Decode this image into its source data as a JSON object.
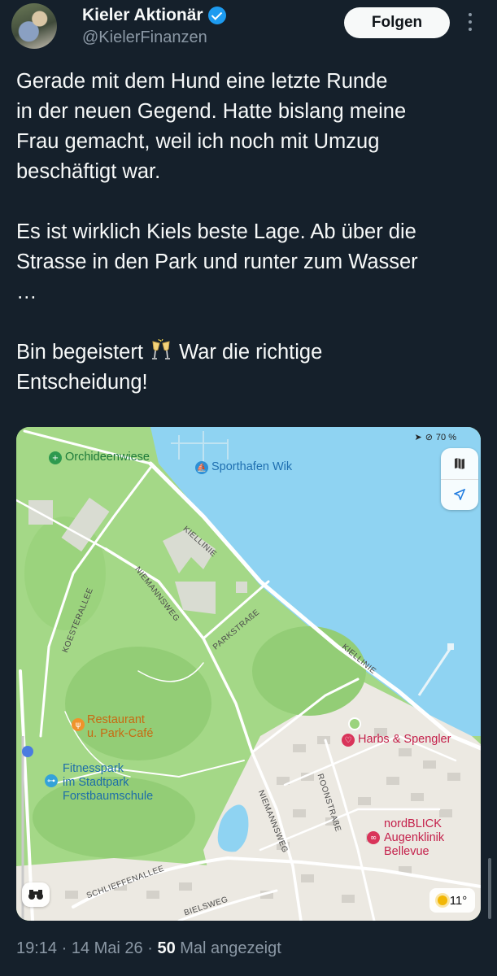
{
  "author": {
    "name": "Kieler Aktionär",
    "handle": "@KielerFinanzen",
    "verified": true,
    "avatar": "avatar-photo"
  },
  "header": {
    "follow_label": "Folgen",
    "more_icon": "more-vertical-icon"
  },
  "tweet": {
    "text_1": "Gerade mit dem Hund eine letzte Runde\nin der neuen Gegend. Hatte bislang meine\nFrau gemacht, weil ich noch mit Umzug\nbeschäftigt war.\n\nEs ist wirklich Kiels beste Lage. Ab über die\nStrasse in den Park und runter zum Wasser\n…\n\nBin begeistert ",
    "emoji": "clinking-glasses-emoji",
    "text_2": " War die richtige\nEntscheidung!"
  },
  "map": {
    "status": {
      "battery": "70 %"
    },
    "pois": {
      "orchideenwiese": "Orchideenwiese",
      "sporthafen": "Sporthafen Wik",
      "restaurant": "Restaurant\nu. Park-Café",
      "fitnesspark": "Fitnesspark\nim Stadtpark\nForstbaumschule",
      "harbs": "Harbs & Spengler",
      "nordblick": "nordBLICK\nAugenklinik\nBellevue"
    },
    "streets": {
      "kiellinie_1": "KIELLINIE",
      "kiellinie_2": "KIELLINIE",
      "koesterallee": "KOESTERALLEE",
      "niemannsweg_1": "NIEMANNSWEG",
      "niemannsweg_2": "NIEMANNSWEG",
      "parkstrasse": "PARKSTRAßE",
      "roonstrasse": "ROONSTRAßE",
      "schlieffenallee": "SCHLIEFFENALLEE",
      "bielsweg": "BIELSWEG"
    },
    "weather": "11°",
    "colors": {
      "water": "#8fd3f2",
      "park": "#a4d887",
      "road": "#ffffff",
      "residential": "#ece9e2"
    }
  },
  "meta": {
    "time": "19:14",
    "date": "14 Mai 26",
    "views_count": "50",
    "views_label": " Mal angezeigt"
  }
}
